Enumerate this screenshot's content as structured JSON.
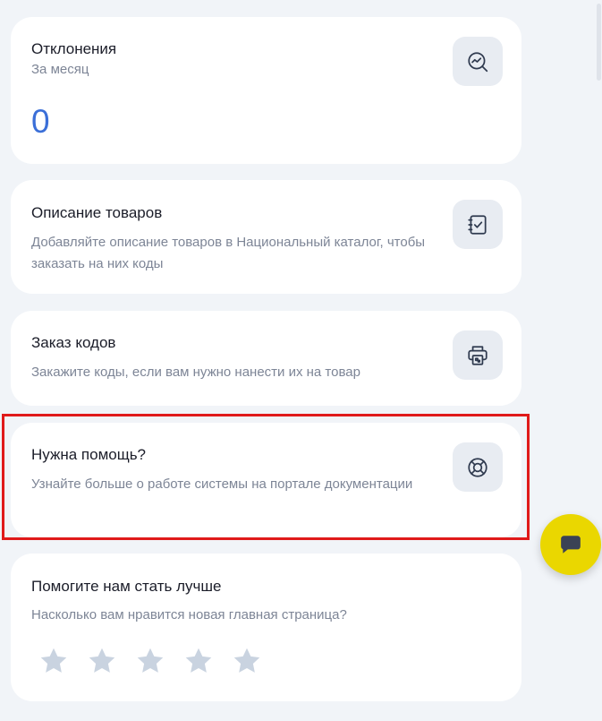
{
  "deviations": {
    "title": "Отклонения",
    "period": "За месяц",
    "count": "0"
  },
  "products": {
    "title": "Описание товаров",
    "description": "Добавляйте описание товаров в Национальный каталог, чтобы заказать на них коды"
  },
  "orders": {
    "title": "Заказ кодов",
    "description": "Закажите коды, если вам нужно нанести их на товар"
  },
  "help": {
    "title": "Нужна помощь?",
    "description": "Узнайте больше о работе системы на портале документации"
  },
  "feedback": {
    "title": "Помогите нам стать лучше",
    "question": "Насколько вам нравится новая главная страница?",
    "rating": 0,
    "max_rating": 5
  },
  "icons": {
    "deviations": "chart-magnifier-icon",
    "products": "checklist-notebook-icon",
    "orders": "printer-code-icon",
    "help": "lifebuoy-icon",
    "chat": "chat-bubble-icon",
    "star": "star-icon"
  },
  "colors": {
    "accent_number": "#3b6fd8",
    "chat_button": "#ead700",
    "highlight_border": "#e01a1a",
    "star_inactive": "#c9d3e0"
  }
}
